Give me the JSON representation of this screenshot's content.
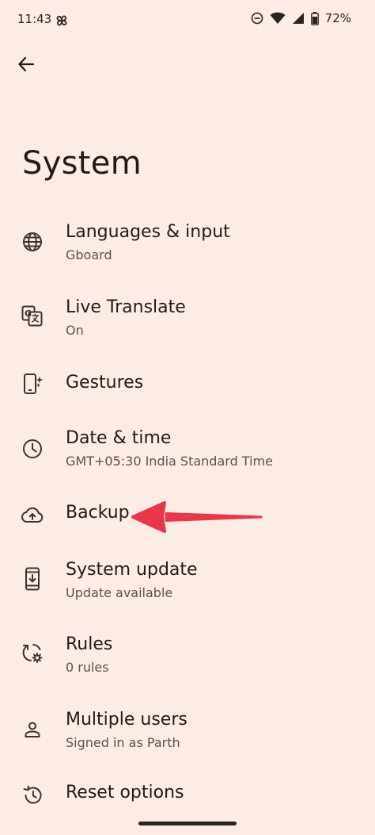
{
  "status_bar": {
    "time": "11:43",
    "battery": "72%"
  },
  "page": {
    "title": "System"
  },
  "items": [
    {
      "label": "Languages & input",
      "sub": "Gboard",
      "icon": "globe-icon"
    },
    {
      "label": "Live Translate",
      "sub": "On",
      "icon": "translate-icon"
    },
    {
      "label": "Gestures",
      "sub": "",
      "icon": "phone-sparkle-icon"
    },
    {
      "label": "Date & time",
      "sub": "GMT+05:30 India Standard Time",
      "icon": "clock-icon"
    },
    {
      "label": "Backup",
      "sub": "",
      "icon": "cloud-upload-icon"
    },
    {
      "label": "System update",
      "sub": "Update available",
      "icon": "system-update-icon"
    },
    {
      "label": "Rules",
      "sub": "0 rules",
      "icon": "rules-icon"
    },
    {
      "label": "Multiple users",
      "sub": "Signed in as Parth",
      "icon": "person-icon"
    },
    {
      "label": "Reset options",
      "sub": "",
      "icon": "history-icon"
    }
  ],
  "colors": {
    "background": "#fdece6",
    "annotation_arrow": "#e8374a"
  }
}
